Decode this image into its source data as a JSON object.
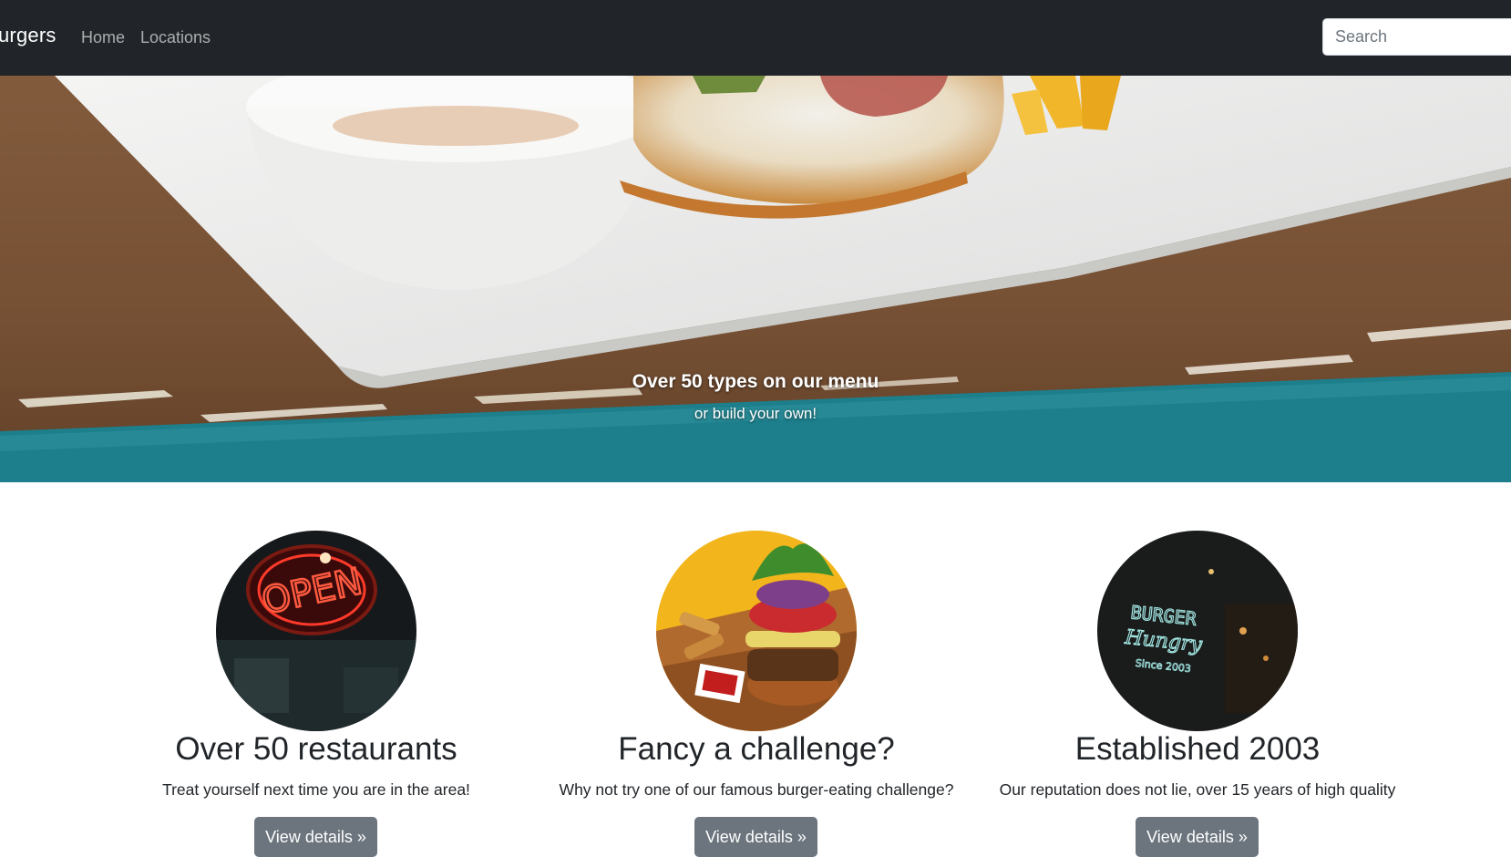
{
  "navbar": {
    "brand": "urgers",
    "links": [
      "Home",
      "Locations"
    ],
    "search": {
      "placeholder": "Search",
      "value": ""
    }
  },
  "hero": {
    "title": "Over 50 types on our menu",
    "subtitle": "or build your own!"
  },
  "features": [
    {
      "heading": "Over 50 restaurants",
      "text": "Treat yourself next time you are in the area!",
      "button": "View details »",
      "image_icon": "open-sign-icon"
    },
    {
      "heading": "Fancy a challenge?",
      "text": "Why not try one of our famous burger-eating challenge?",
      "button": "View details »",
      "image_icon": "burger-plate-icon"
    },
    {
      "heading": "Established 2003",
      "text": "Our reputation does not lie, over 15 years of high quality",
      "button": "View details »",
      "image_icon": "burger-neon-sign-icon"
    }
  ],
  "colors": {
    "navbar_bg": "#212529",
    "button_bg": "#6c757d",
    "text": "#212529"
  }
}
